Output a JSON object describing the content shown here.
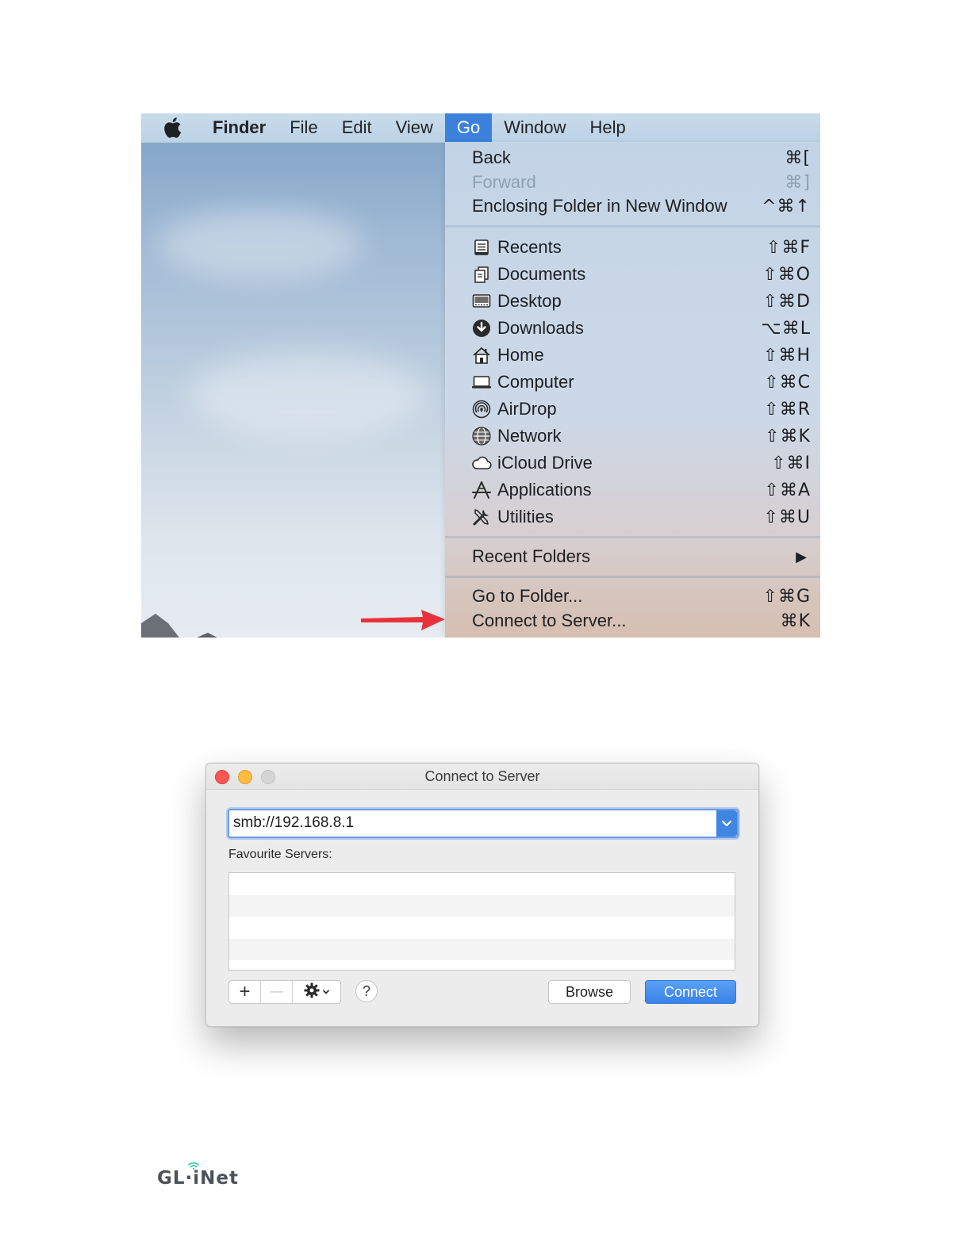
{
  "menubar": {
    "app_name": "Finder",
    "items": [
      "File",
      "Edit",
      "View",
      "Go",
      "Window",
      "Help"
    ],
    "active_item": "Go"
  },
  "go_menu": {
    "group1": [
      {
        "label": "Back",
        "shortcut": "⌘[",
        "enabled": true
      },
      {
        "label": "Forward",
        "shortcut": "⌘]",
        "enabled": false
      },
      {
        "label": "Enclosing Folder in New Window",
        "shortcut": "^⌘↑",
        "enabled": true
      }
    ],
    "group2": [
      {
        "label": "Recents",
        "shortcut": "⇧⌘F",
        "icon": "recents-icon"
      },
      {
        "label": "Documents",
        "shortcut": "⇧⌘O",
        "icon": "documents-icon"
      },
      {
        "label": "Desktop",
        "shortcut": "⇧⌘D",
        "icon": "desktop-icon"
      },
      {
        "label": "Downloads",
        "shortcut": "⌥⌘L",
        "icon": "downloads-icon"
      },
      {
        "label": "Home",
        "shortcut": "⇧⌘H",
        "icon": "home-icon"
      },
      {
        "label": "Computer",
        "shortcut": "⇧⌘C",
        "icon": "computer-icon"
      },
      {
        "label": "AirDrop",
        "shortcut": "⇧⌘R",
        "icon": "airdrop-icon"
      },
      {
        "label": "Network",
        "shortcut": "⇧⌘K",
        "icon": "network-icon"
      },
      {
        "label": "iCloud Drive",
        "shortcut": "⇧⌘I",
        "icon": "icloud-icon"
      },
      {
        "label": "Applications",
        "shortcut": "⇧⌘A",
        "icon": "applications-icon"
      },
      {
        "label": "Utilities",
        "shortcut": "⇧⌘U",
        "icon": "utilities-icon"
      }
    ],
    "recent_folders": {
      "label": "Recent Folders",
      "submenu_indicator": "▶"
    },
    "group4": [
      {
        "label": "Go to Folder...",
        "shortcut": "⇧⌘G"
      },
      {
        "label": "Connect to Server...",
        "shortcut": "⌘K"
      }
    ]
  },
  "annotation": {
    "arrow_color": "#e8323a",
    "points_to": "Connect to Server..."
  },
  "dialog": {
    "title": "Connect to Server",
    "server_address": "smb://192.168.8.1",
    "favourites_label": "Favourite Servers:",
    "favourite_servers": [],
    "add_symbol": "+",
    "remove_symbol": "—",
    "help_symbol": "?",
    "browse_label": "Browse",
    "connect_label": "Connect"
  },
  "logo": {
    "text": "GL·iNet"
  },
  "colors": {
    "menu_highlight": "#3c82dc",
    "connect_button": "#3a82e8",
    "close": "#fc5753",
    "minimize": "#fdbc40",
    "logo_accent": "#2ec4a5"
  }
}
